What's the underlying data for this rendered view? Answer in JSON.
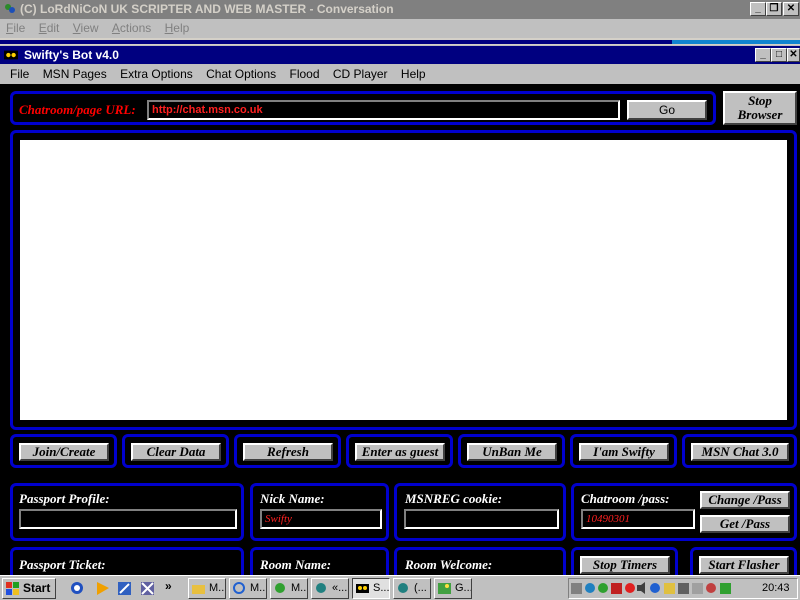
{
  "outer_window": {
    "title": "(C) LoRdNiCoN UK SCRIPTER AND WEB MASTER - Conversation",
    "menu": [
      "File",
      "Edit",
      "View",
      "Actions",
      "Help"
    ],
    "controls": {
      "minimize": "_",
      "restore": "❐",
      "close": "✕"
    }
  },
  "app_window": {
    "title": "Swifty's Bot v4.0",
    "menu": [
      "File",
      "MSN Pages",
      "Extra Options",
      "Chat Options",
      "Flood",
      "CD Player",
      "Help"
    ],
    "controls": {
      "minimize": "_",
      "maximize": "□",
      "close": "✕"
    }
  },
  "url_bar": {
    "label": "Chatroom/page URL:",
    "value": "http://chat.msn.co.uk",
    "go_label": "Go",
    "stop_label_1": "Stop",
    "stop_label_2": "Browser"
  },
  "actions": [
    "Join/Create",
    "Clear Data",
    "Refresh",
    "Enter as guest",
    "UnBan Me",
    "I'am Swifty",
    "MSN Chat 3.0"
  ],
  "fields": {
    "passport_profile": {
      "label": "Passport Profile:",
      "value": ""
    },
    "nick_name": {
      "label": "Nick Name:",
      "value": "Swifty"
    },
    "msnreg_cookie": {
      "label": "MSNREG cookie:",
      "value": ""
    },
    "chatroom_pass": {
      "label": "Chatroom /pass:",
      "value": "10490301"
    },
    "change_pass_label": "Change /Pass",
    "get_pass_label": "Get /Pass",
    "passport_ticket": {
      "label": "Passport Ticket:"
    },
    "room_name": {
      "label": "Room Name:"
    },
    "room_welcome": {
      "label": "Room Welcome:"
    },
    "stop_timers_label": "Stop Timers",
    "start_flasher_label": "Start Flasher"
  },
  "taskbar": {
    "start_label": "Start",
    "chevron": "»",
    "items": [
      "M...",
      "M...",
      "M...",
      "«...",
      "S...",
      "(...",
      "G..."
    ],
    "clock": "20:43"
  },
  "colors": {
    "panel_border": "#0000cc",
    "label_red": "#ff0000",
    "title_active": "#000080"
  }
}
